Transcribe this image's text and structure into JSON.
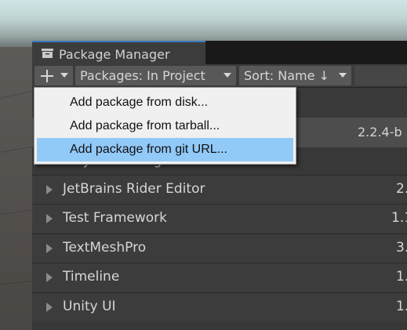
{
  "window": {
    "title": "Package Manager",
    "tab_icon": "package-icon"
  },
  "toolbar": {
    "add_icon": "plus-icon",
    "packages_label": "Packages: In Project",
    "sort_label": "Sort: Name ↓"
  },
  "menu": {
    "items": [
      {
        "label": "Add package from disk...",
        "highlighted": false
      },
      {
        "label": "Add package from tarball...",
        "highlighted": false
      },
      {
        "label": "Add package from git URL...",
        "highlighted": true
      }
    ]
  },
  "list": {
    "selected_version": "2.2.4-b",
    "group_header": "Unity Technologies",
    "packages": [
      {
        "name": "JetBrains Rider Editor",
        "version": "2."
      },
      {
        "name": "Test Framework",
        "version": "1.1"
      },
      {
        "name": "TextMeshPro",
        "version": "3."
      },
      {
        "name": "Timeline",
        "version": "1."
      },
      {
        "name": "Unity UI",
        "version": "1."
      }
    ]
  },
  "colors": {
    "accent_tab_border": "#3a79bb",
    "menu_highlight": "#91c9f7",
    "window_bg": "#383838"
  }
}
